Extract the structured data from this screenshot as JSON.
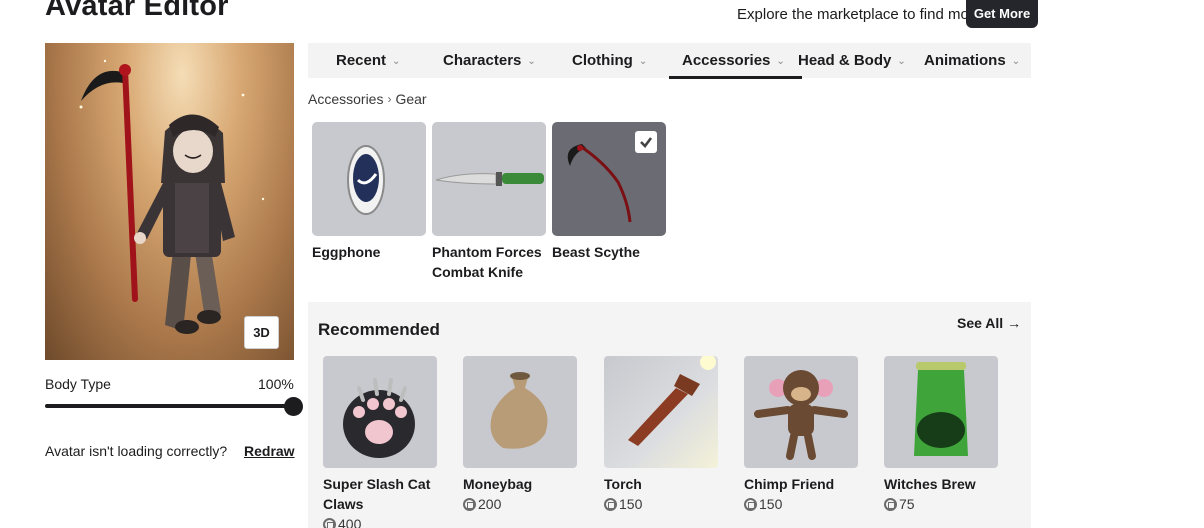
{
  "header": {
    "title": "Avatar Editor",
    "promo_text": "Explore the marketplace to find more clothes!",
    "get_more_label": "Get More"
  },
  "preview": {
    "toggle_3d_label": "3D",
    "body_type_label": "Body Type",
    "body_type_value": "100%",
    "body_type_fraction": 1.0,
    "loading_prompt": "Avatar isn't loading correctly?",
    "redraw_label": "Redraw"
  },
  "tabs": [
    {
      "label": "Recent"
    },
    {
      "label": "Characters"
    },
    {
      "label": "Clothing"
    },
    {
      "label": "Accessories",
      "active": true
    },
    {
      "label": "Head & Body"
    },
    {
      "label": "Animations"
    }
  ],
  "breadcrumb": {
    "parent": "Accessories",
    "current": "Gear"
  },
  "items": [
    {
      "name": "Eggphone",
      "selected": false
    },
    {
      "name": "Phantom Forces Combat Knife",
      "selected": false
    },
    {
      "name": "Beast Scythe",
      "selected": true
    }
  ],
  "recommended": {
    "title": "Recommended",
    "see_all_label": "See All",
    "items": [
      {
        "name": "Super Slash Cat Claws",
        "price": "400"
      },
      {
        "name": "Moneybag",
        "price": "200"
      },
      {
        "name": "Torch",
        "price": "150"
      },
      {
        "name": "Chimp Friend",
        "price": "150"
      },
      {
        "name": "Witches Brew",
        "price": "75"
      }
    ]
  },
  "colors": {
    "accent_dark": "#1c1c1e",
    "button_dark": "#24262b",
    "tab_bg": "#f3f3f3",
    "thumb_bg": "#c8c9ce",
    "selected_thumb_bg": "#6b6c73"
  }
}
